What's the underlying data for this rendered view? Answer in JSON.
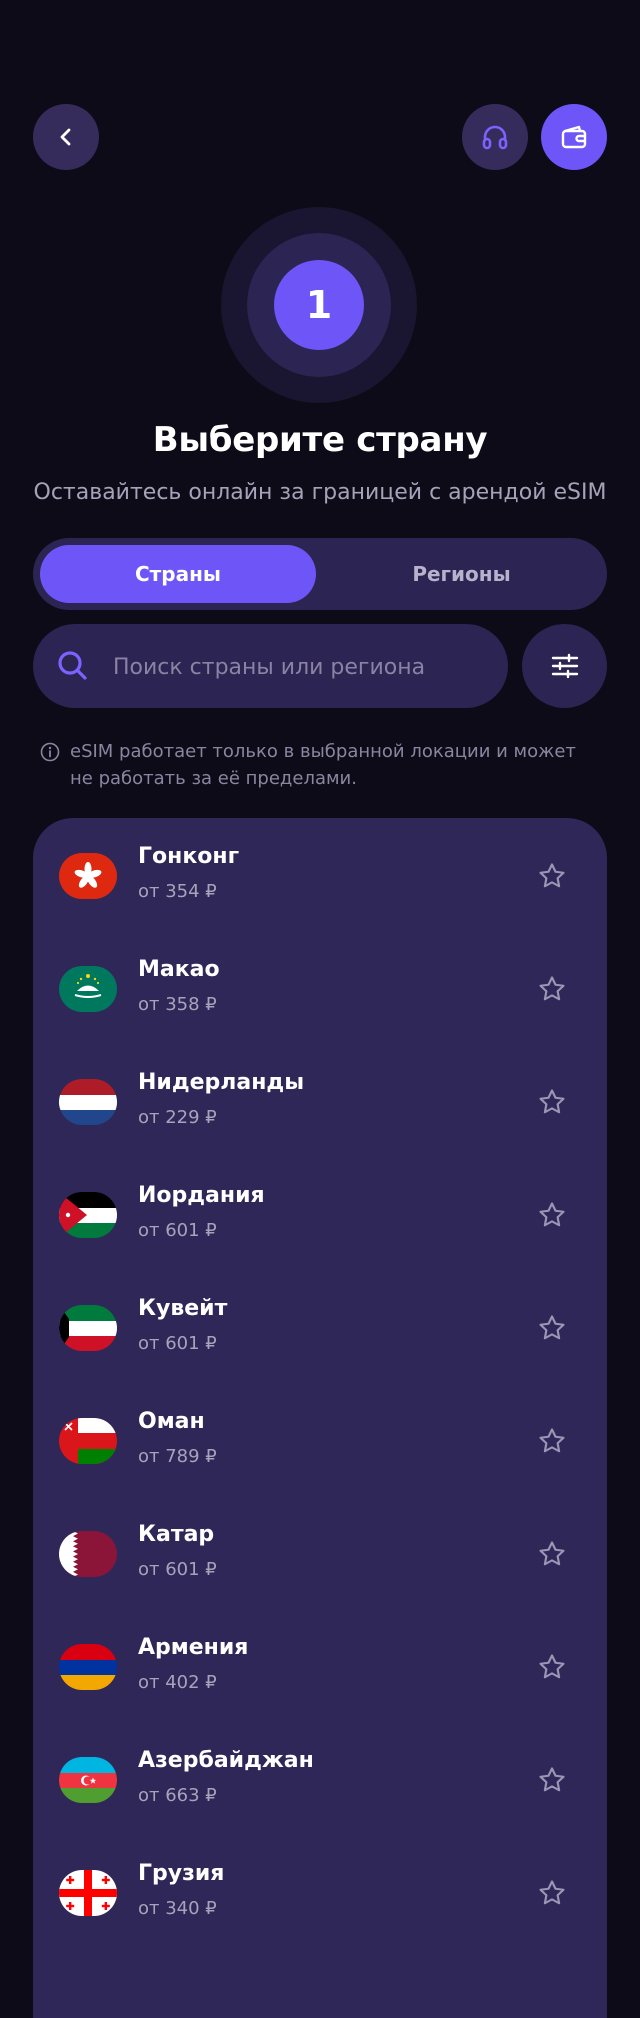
{
  "header": {
    "back_icon": "chevron-left-icon",
    "support_icon": "headphones-icon",
    "wallet_icon": "wallet-icon"
  },
  "step": {
    "number": "1"
  },
  "title": "Выберите страну",
  "subtitle": "Оставайтесь онлайн за границей с арендой eSIM",
  "tabs": [
    {
      "label": "Страны",
      "active": true
    },
    {
      "label": "Регионы",
      "active": false
    }
  ],
  "search": {
    "placeholder": "Поиск страны или региона",
    "value": ""
  },
  "notice": "eSIM работает только в выбранной локации и может не работать за её пределами.",
  "colors": {
    "background": "#0d0b18",
    "accent": "#6e55f7",
    "surface": "#2c2452",
    "list_surface": "#2f2758"
  },
  "countries": [
    {
      "name": "Гонконг",
      "price": "от 354 ₽",
      "flag": "hong-kong-flag"
    },
    {
      "name": "Макао",
      "price": "от 358 ₽",
      "flag": "macao-flag"
    },
    {
      "name": "Нидерланды",
      "price": "от 229 ₽",
      "flag": "netherlands-flag"
    },
    {
      "name": "Иордания",
      "price": "от 601 ₽",
      "flag": "jordan-flag"
    },
    {
      "name": "Кувейт",
      "price": "от 601 ₽",
      "flag": "kuwait-flag"
    },
    {
      "name": "Оман",
      "price": "от 789 ₽",
      "flag": "oman-flag"
    },
    {
      "name": "Катар",
      "price": "от 601 ₽",
      "flag": "qatar-flag"
    },
    {
      "name": "Армения",
      "price": "от 402 ₽",
      "flag": "armenia-flag"
    },
    {
      "name": "Азербайджан",
      "price": "от 663 ₽",
      "flag": "azerbaijan-flag"
    },
    {
      "name": "Грузия",
      "price": "от 340 ₽",
      "flag": "georgia-flag"
    }
  ]
}
